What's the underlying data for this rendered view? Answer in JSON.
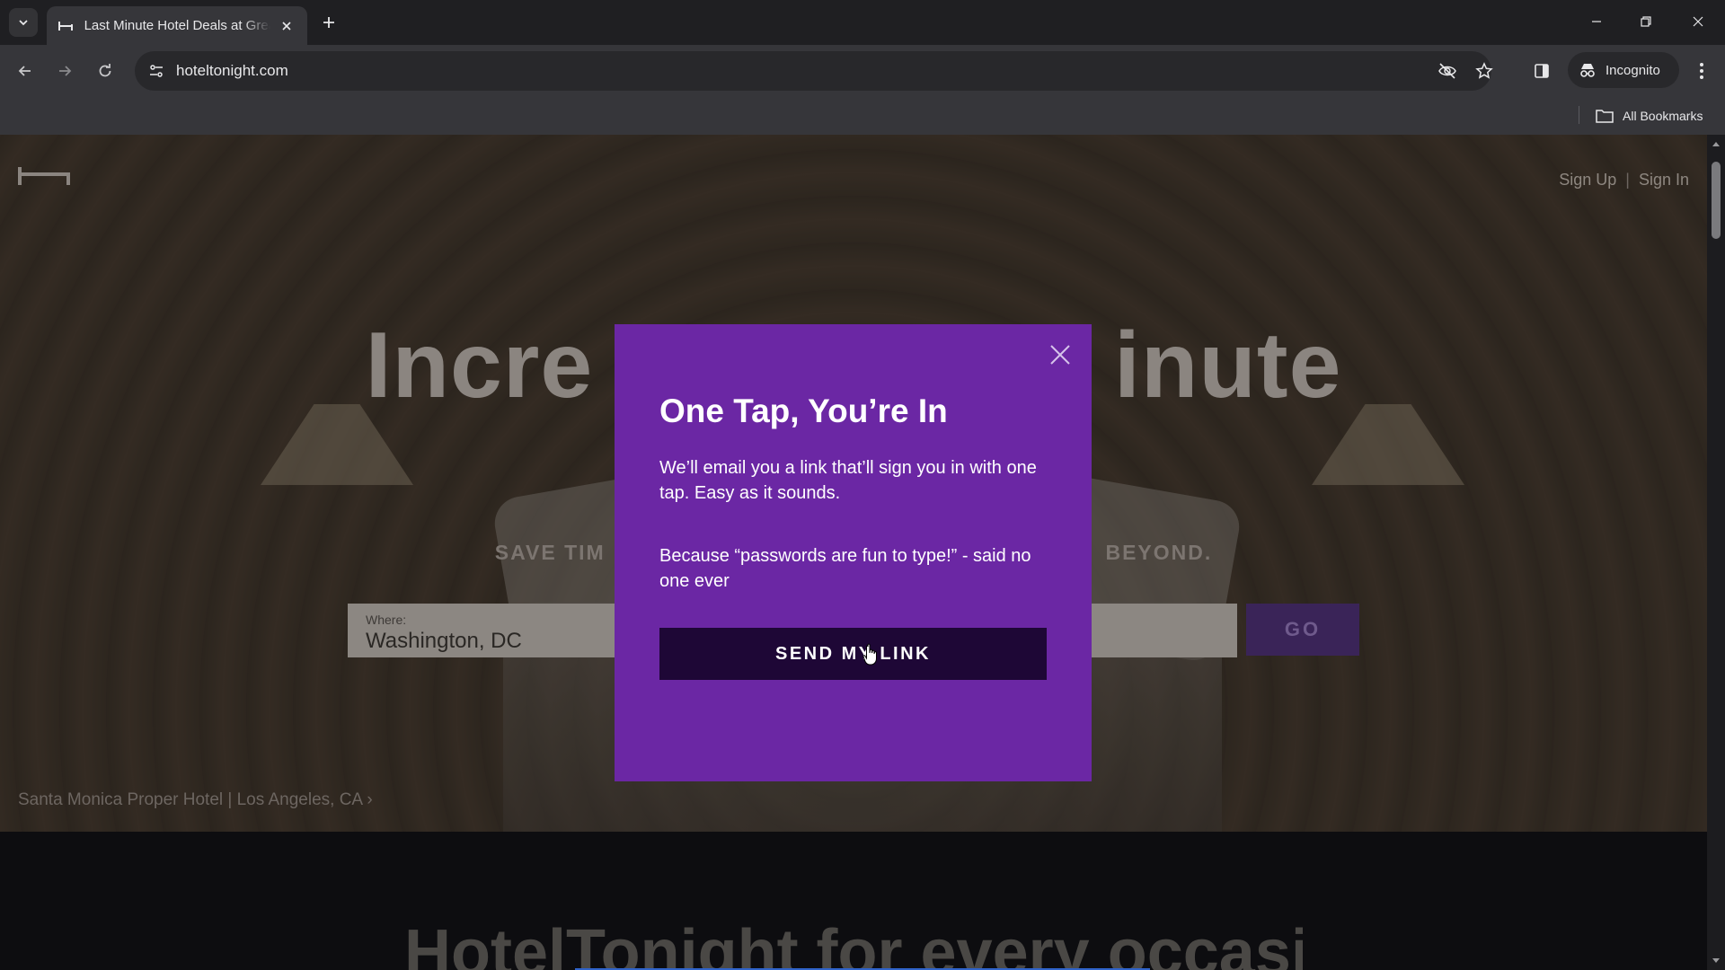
{
  "browser": {
    "tab_title": "Last Minute Hotel Deals at Great Prices",
    "url": "hoteltonight.com",
    "incognito_label": "Incognito",
    "all_bookmarks_label": "All Bookmarks"
  },
  "page": {
    "header": {
      "sign_up": "Sign Up",
      "separator": "|",
      "sign_in": "Sign In"
    },
    "hero": {
      "title_left": "Incre",
      "title_right": "inute",
      "subtitle_left": "SAVE TIM",
      "subtitle_right": "BEYOND."
    },
    "search": {
      "where_label": "Where:",
      "where_value": "Washington, DC",
      "go_label": "GO"
    },
    "photo_caption": "Santa Monica Proper Hotel | Los Angeles, CA",
    "photo_caption_arrow": "›",
    "below_title": "HotelTonight for every occasion"
  },
  "modal": {
    "title": "One Tap, You’re In",
    "paragraph1": "We’ll email you a link that’ll sign you in with one tap. Easy as it sounds.",
    "paragraph2": "Because “passwords are fun to type!” - said no one ever",
    "send_button": "SEND MY LINK"
  },
  "colors": {
    "modal_bg": "#6b27a4",
    "send_button_bg": "#1e0736",
    "go_button_bg": "#3a2458"
  }
}
